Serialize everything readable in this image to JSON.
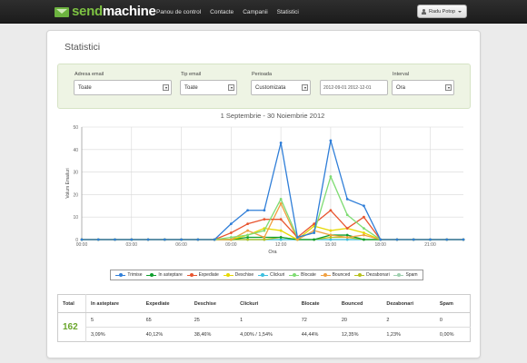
{
  "nav": {
    "logo_part1": "send",
    "logo_part2": "machine",
    "links": [
      "Panou de control",
      "Contacte",
      "Campanii",
      "Statistici"
    ],
    "user": "Radu Potop"
  },
  "page": {
    "title": "Statistici"
  },
  "filters": {
    "email_label": "Adresa email",
    "email_value": "Toate",
    "type_label": "Tip email",
    "type_value": "Toate",
    "period_label": "Perioada",
    "period_value": "Customizata",
    "date_range": "2012-09-01 2012-12-01",
    "interval_label": "Interval",
    "interval_value": "Ora"
  },
  "chart_data": {
    "type": "line",
    "title": "1 Septembrie - 30 Noiembrie 2012",
    "xlabel": "Ora",
    "ylabel": "Volum Emailuri",
    "ylim": [
      0,
      50
    ],
    "yticks": [
      0,
      10,
      20,
      30,
      40,
      50
    ],
    "xlim": [
      0,
      23
    ],
    "xticks": [
      "00:00",
      "03:00",
      "06:00",
      "09:00",
      "12:00",
      "15:00",
      "18:00",
      "21:00"
    ],
    "x": [
      0,
      1,
      2,
      3,
      4,
      5,
      6,
      7,
      8,
      9,
      10,
      11,
      12,
      13,
      14,
      15,
      16,
      17,
      18,
      19,
      20,
      21,
      22,
      23
    ],
    "legend_position": "bottom",
    "grid": true,
    "series": [
      {
        "name": "Trimise",
        "color": "#2f7ed8",
        "values": [
          0,
          0,
          0,
          0,
          0,
          0,
          0,
          0,
          0,
          7,
          13,
          13,
          43,
          1,
          3,
          44,
          18,
          15,
          0,
          0,
          0,
          0,
          0,
          0
        ]
      },
      {
        "name": "In asteptare",
        "color": "#0d9e2d",
        "values": [
          0,
          0,
          0,
          0,
          0,
          0,
          0,
          0,
          0,
          0,
          1,
          1,
          1,
          0,
          0,
          2,
          2,
          0,
          0,
          0,
          0,
          0,
          0,
          0
        ]
      },
      {
        "name": "Expediate",
        "color": "#e8542e",
        "values": [
          0,
          0,
          0,
          0,
          0,
          0,
          0,
          0,
          0,
          3,
          7,
          9,
          9,
          1,
          7,
          13,
          5,
          10,
          0,
          0,
          0,
          0,
          0,
          0
        ]
      },
      {
        "name": "Deschise",
        "color": "#e6d800",
        "values": [
          0,
          0,
          0,
          0,
          0,
          0,
          0,
          0,
          0,
          0,
          2,
          5,
          4,
          0,
          6,
          4,
          5,
          3,
          0,
          0,
          0,
          0,
          0,
          0
        ]
      },
      {
        "name": "Clickuri",
        "color": "#3cc0e0",
        "values": [
          0,
          0,
          0,
          0,
          0,
          0,
          0,
          0,
          0,
          0,
          0,
          0,
          0,
          0,
          0,
          0,
          0,
          0,
          0,
          0,
          0,
          0,
          0,
          0
        ]
      },
      {
        "name": "Blocate",
        "color": "#7fdc73",
        "values": [
          0,
          0,
          0,
          0,
          0,
          0,
          0,
          0,
          0,
          1,
          2,
          4,
          18,
          1,
          3,
          28,
          11,
          5,
          0,
          0,
          0,
          0,
          0,
          0
        ]
      },
      {
        "name": "Bounced",
        "color": "#f0a040",
        "values": [
          0,
          0,
          0,
          0,
          0,
          0,
          0,
          0,
          0,
          0,
          4,
          1,
          16,
          0,
          4,
          2,
          1,
          2,
          0,
          0,
          0,
          0,
          0,
          0
        ]
      },
      {
        "name": "Dezabonari",
        "color": "#b6c01c",
        "values": [
          0,
          0,
          0,
          0,
          0,
          0,
          0,
          0,
          0,
          0,
          0,
          0,
          1,
          0,
          0,
          1,
          1,
          0,
          0,
          0,
          0,
          0,
          0,
          0
        ]
      },
      {
        "name": "Spam",
        "color": "#a0d0b0",
        "values": [
          0,
          0,
          0,
          0,
          0,
          0,
          0,
          0,
          0,
          0,
          0,
          0,
          0,
          0,
          0,
          0,
          0,
          0,
          0,
          0,
          0,
          0,
          0,
          0
        ]
      }
    ]
  },
  "table": {
    "headers": [
      "Total",
      "In asteptare",
      "Expediate",
      "Deschise",
      "Clickuri",
      "Blocate",
      "Bounced",
      "Dezabonari",
      "Spam"
    ],
    "total": "162",
    "counts": [
      "5",
      "65",
      "25",
      "1",
      "72",
      "20",
      "2",
      "0"
    ],
    "percents": [
      "3,09%",
      "40,12%",
      "38,46%",
      "4,00% / 1,54%",
      "44,44%",
      "12,35%",
      "1,23%",
      "0,00%"
    ]
  }
}
